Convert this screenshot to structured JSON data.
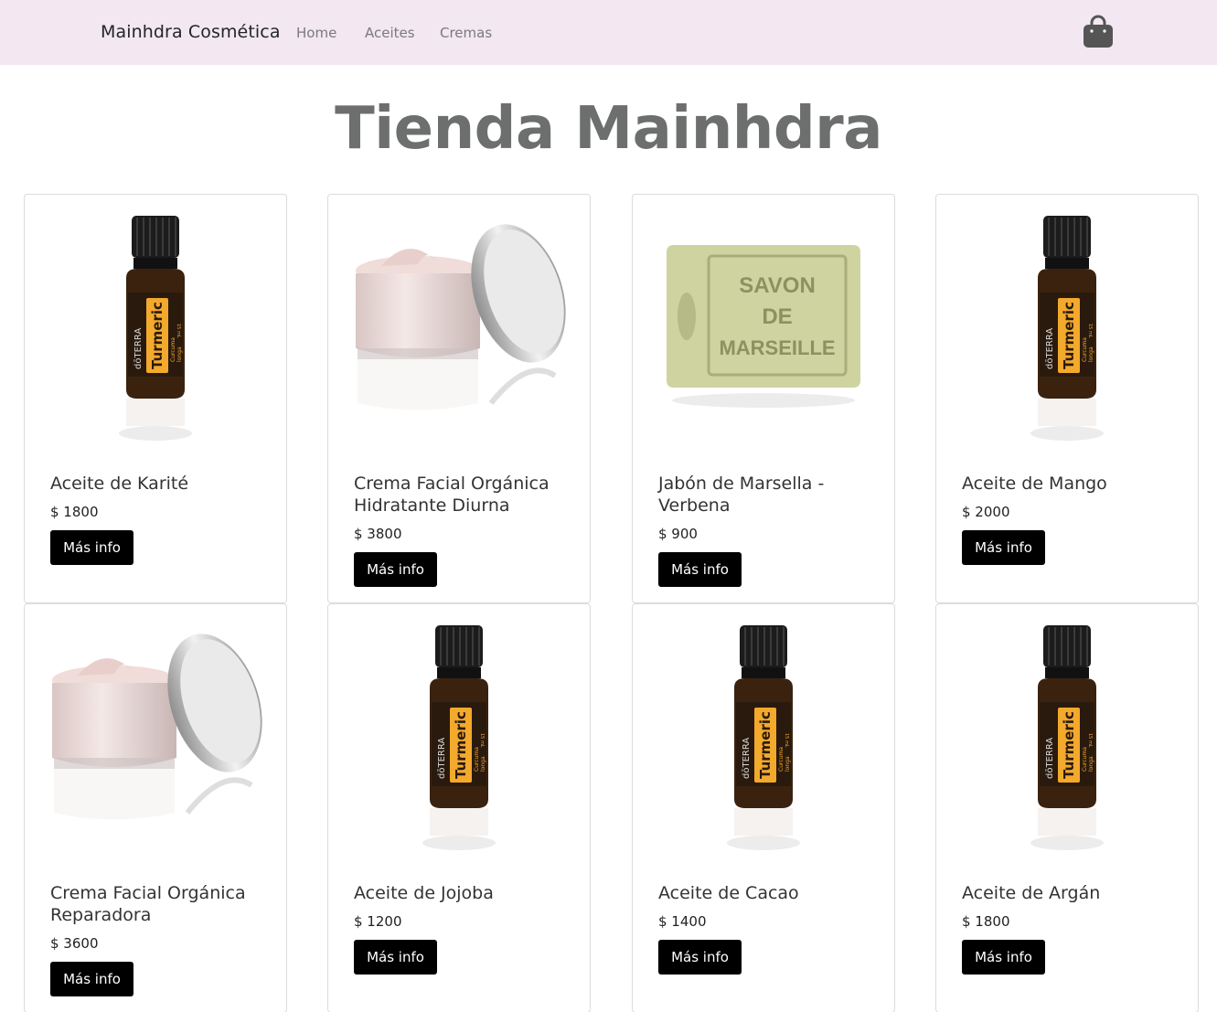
{
  "navbar": {
    "brand": "Mainhdra Cosmética",
    "links": [
      "Home",
      "Aceites",
      "Cremas"
    ],
    "cart_icon": "shopping-bag-icon"
  },
  "page": {
    "title": "Tienda Mainhdra"
  },
  "products": [
    {
      "name": "Aceite de Karité",
      "price": "$ 1800",
      "button": "Más info",
      "image": "oil-bottle"
    },
    {
      "name": "Crema Facial Orgánica Hidratante Diurna",
      "price": "$ 3800",
      "button": "Más info",
      "image": "cream-jar"
    },
    {
      "name": "Jabón de Marsella - Verbena",
      "price": "$ 900",
      "button": "Más info",
      "image": "soap-bar"
    },
    {
      "name": "Aceite de Mango",
      "price": "$ 2000",
      "button": "Más info",
      "image": "oil-bottle"
    },
    {
      "name": "Crema Facial Orgánica Reparadora",
      "price": "$ 3600",
      "button": "Más info",
      "image": "cream-jar"
    },
    {
      "name": "Aceite de Jojoba",
      "price": "$ 1200",
      "button": "Más info",
      "image": "oil-bottle"
    },
    {
      "name": "Aceite de Cacao",
      "price": "$ 1400",
      "button": "Más info",
      "image": "oil-bottle"
    },
    {
      "name": "Aceite de Argán",
      "price": "$ 1800",
      "button": "Más info",
      "image": "oil-bottle"
    }
  ],
  "image_labels": {
    "bottle_brand": "dōTERRA",
    "bottle_name": "Turmeric",
    "bottle_sub1": "Curcuma",
    "bottle_sub2": "longa",
    "bottle_size": "15 mL",
    "soap_line1": "SAVON",
    "soap_line2": "DE",
    "soap_line3": "MARSEILLE"
  },
  "colors": {
    "navbar_bg": "#f3e7f1",
    "button_bg": "#000000",
    "title": "#6c6f6e"
  }
}
